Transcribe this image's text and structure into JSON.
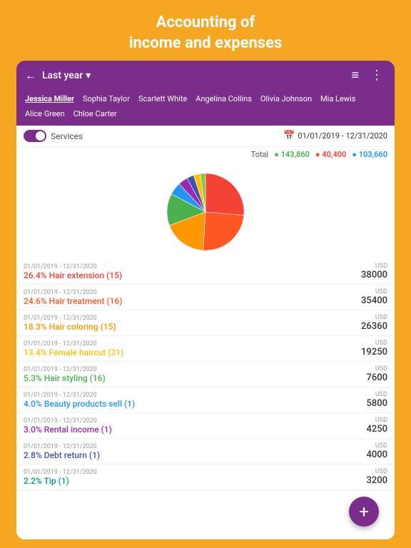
{
  "app": {
    "title_line1": "Accounting of",
    "title_line2": "income and expenses"
  },
  "toolbar": {
    "back_icon": "←",
    "period": "Last year",
    "dropdown_icon": "▾",
    "menu_icon": "≡",
    "more_icon": "⋮"
  },
  "users": [
    {
      "name": "Jessica Miller",
      "active": true
    },
    {
      "name": "Sophia Taylor",
      "active": false
    },
    {
      "name": "Scarlett White",
      "active": false
    },
    {
      "name": "Angelina Collins",
      "active": false
    },
    {
      "name": "Olivia Johnson",
      "active": false
    },
    {
      "name": "Mia Lewis",
      "active": false
    },
    {
      "name": "Alice Green",
      "active": false
    },
    {
      "name": "Chloe Carter",
      "active": false
    }
  ],
  "filter": {
    "toggle_label": "Services",
    "date_range": "01/01/2019 - 12/31/2020"
  },
  "totals": {
    "label": "Total",
    "green": "143,860",
    "red": "40,400",
    "blue": "103,660"
  },
  "chart": {
    "segments": [
      {
        "percent": 26.4,
        "color": "#F44336",
        "startAngle": 0
      },
      {
        "percent": 24.6,
        "color": "#FF5722",
        "startAngle": 95
      },
      {
        "percent": 18.3,
        "color": "#FF9800",
        "startAngle": 184
      },
      {
        "percent": 13.4,
        "color": "#4CAF50",
        "startAngle": 250
      },
      {
        "percent": 5.3,
        "color": "#2196F3",
        "startAngle": 298
      },
      {
        "percent": 4.0,
        "color": "#9C27B0",
        "startAngle": 317
      },
      {
        "percent": 3.0,
        "color": "#3F51B5",
        "startAngle": 331
      },
      {
        "percent": 2.8,
        "color": "#FFC107",
        "startAngle": 342
      },
      {
        "percent": 2.2,
        "color": "#8BC34A",
        "startAngle": 352
      }
    ]
  },
  "items": [
    {
      "date": "01/01/2019 - 12/31/2020",
      "name": "26.4% Hair extension (15)",
      "currency": "USD",
      "amount": "38000",
      "color_class": "color-1"
    },
    {
      "date": "01/01/2019 - 12/31/2020",
      "name": "24.6% Hair treatment (16)",
      "currency": "USD",
      "amount": "35400",
      "color_class": "color-2"
    },
    {
      "date": "01/01/2019 - 12/31/2020",
      "name": "18.3% Hair coloring (15)",
      "currency": "USD",
      "amount": "26360",
      "color_class": "color-3"
    },
    {
      "date": "01/01/2019 - 12/31/2020",
      "name": "13.4% Female haircut (31)",
      "currency": "USD",
      "amount": "19250",
      "color_class": "color-4"
    },
    {
      "date": "01/01/2019 - 12/31/2020",
      "name": "5.3% Hair styling (16)",
      "currency": "USD",
      "amount": "7600",
      "color_class": "color-5"
    },
    {
      "date": "01/01/2019 - 12/31/2020",
      "name": "4.0% Beauty products sell (1)",
      "currency": "USD",
      "amount": "5800",
      "color_class": "color-6"
    },
    {
      "date": "01/01/2019 - 12/31/2020",
      "name": "3.0% Rental income (1)",
      "currency": "USD",
      "amount": "4250",
      "color_class": "color-7"
    },
    {
      "date": "01/01/2019 - 12/31/2020",
      "name": "2.8% Debt return (1)",
      "currency": "USD",
      "amount": "4000",
      "color_class": "color-8"
    },
    {
      "date": "01/01/2019 - 12/31/2020",
      "name": "2.2% Tip (1)",
      "currency": "USD",
      "amount": "3200",
      "color_class": "color-9"
    }
  ],
  "fab": {
    "label": "+"
  }
}
